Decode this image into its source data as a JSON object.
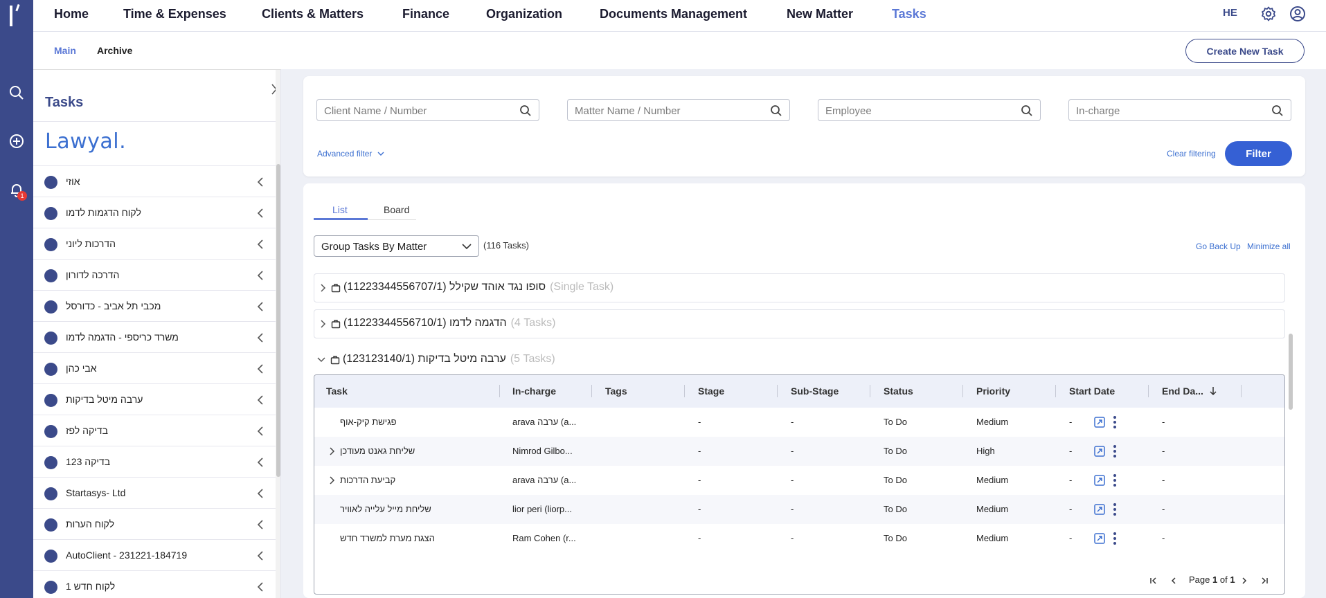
{
  "topnav": {
    "items": [
      "Home",
      "Time & Expenses",
      "Clients & Matters",
      "Finance",
      "Organization",
      "Documents Management",
      "New Matter",
      "Tasks"
    ],
    "active": "Tasks",
    "language": "HE"
  },
  "rail": {
    "notification_count": "1"
  },
  "subnav": {
    "main": "Main",
    "archive": "Archive",
    "create_button": "Create New Task"
  },
  "sidebar": {
    "title": "Tasks",
    "logo_text": "Lawyal.",
    "clients": [
      "אוזי",
      "לקוח הדגמות לדמו",
      "הדרכות ליוני",
      "הדרכה לדורון",
      "מכבי תל אביב - כדורסל",
      "משרד כריספי - הדגמה לדמו",
      "אבי כהן",
      "ערבה מיטל בדיקות",
      "בדיקה לפז",
      "בדיקה 123",
      "Startasys- Ltd",
      "לקוח הערות",
      "AutoClient - 231221-184719",
      "לקוח חדש 1"
    ]
  },
  "filters": {
    "client_placeholder": "Client Name / Number",
    "matter_placeholder": "Matter Name / Number",
    "employee_placeholder": "Employee",
    "incharge_placeholder": "In-charge",
    "advanced": "Advanced filter",
    "clear": "Clear filtering",
    "filter_button": "Filter"
  },
  "view": {
    "tabs": [
      "List",
      "Board"
    ],
    "active_tab": "List",
    "group_by": "Group Tasks By Matter",
    "task_count": "(116 Tasks)",
    "go_back_up": "Go Back Up",
    "minimize_all": "Minimize all"
  },
  "matters": [
    {
      "name": "סופו נגד אוהד שקילל (11223344556707/1)",
      "count": "(Single Task)"
    },
    {
      "name": "הדגמה לדמו (11223344556710/1)",
      "count": "(4 Tasks)"
    },
    {
      "name": "ערבה מיטל בדיקות (123123140/1)",
      "count": "(5 Tasks)"
    }
  ],
  "table": {
    "columns": [
      "Task",
      "In-charge",
      "Tags",
      "Stage",
      "Sub-Stage",
      "Status",
      "Priority",
      "Start Date",
      "End Da..."
    ],
    "rows": [
      {
        "task": "פגישת קיק-אוף",
        "incharge": "arava ערבה (a...",
        "tags": "",
        "stage": "-",
        "substage": "-",
        "status": "To Do",
        "priority": "Medium",
        "start": "-",
        "end": "-",
        "expandable": false
      },
      {
        "task": "שליחת גאנט מעודכן",
        "incharge": "Nimrod Gilbo...",
        "tags": "",
        "stage": "-",
        "substage": "-",
        "status": "To Do",
        "priority": "High",
        "start": "-",
        "end": "-",
        "expandable": true
      },
      {
        "task": "קביעת הדרכות",
        "incharge": "arava ערבה (a...",
        "tags": "",
        "stage": "-",
        "substage": "-",
        "status": "To Do",
        "priority": "Medium",
        "start": "-",
        "end": "-",
        "expandable": true
      },
      {
        "task": "שליחת מייל עלייה לאוויר",
        "incharge": "lior peri (liorp...",
        "tags": "",
        "stage": "-",
        "substage": "-",
        "status": "To Do",
        "priority": "Medium",
        "start": "-",
        "end": "-",
        "expandable": false
      },
      {
        "task": "הצגת מערת למשרד חדש",
        "incharge": "Ram Cohen (r...",
        "tags": "",
        "stage": "-",
        "substage": "-",
        "status": "To Do",
        "priority": "Medium",
        "start": "-",
        "end": "-",
        "expandable": false
      }
    ],
    "pagination": {
      "page_word": "Page",
      "current": "1",
      "of_word": "of",
      "total": "1"
    }
  },
  "colors": {
    "rail": "#3b4a8a",
    "accent": "#5b78d6",
    "primary_button": "#3560d4"
  }
}
